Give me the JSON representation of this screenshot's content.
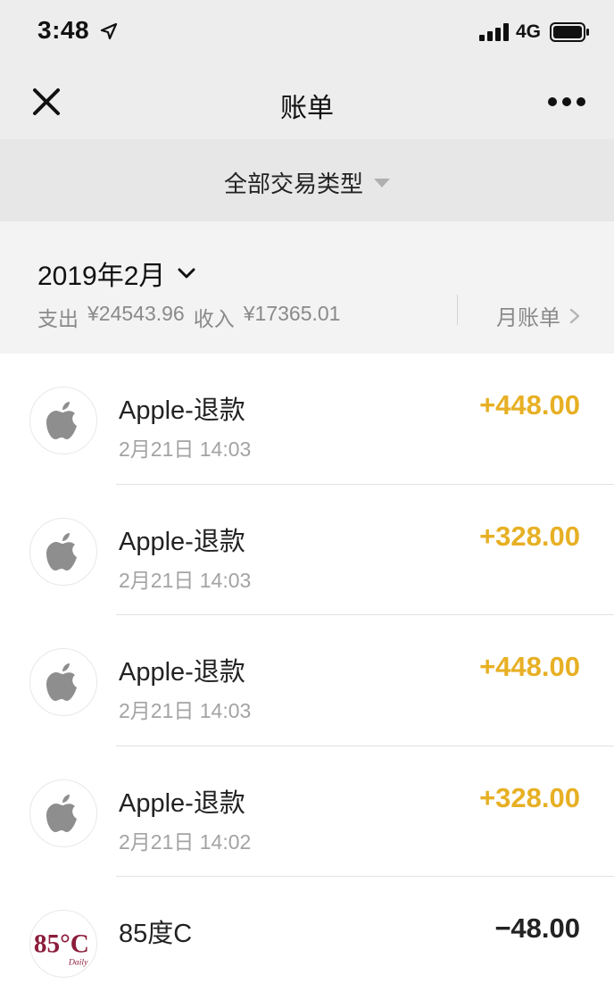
{
  "status_bar": {
    "time": "3:48",
    "network": "4G",
    "icons": [
      "location-arrow-icon",
      "signal-bars-icon",
      "battery-icon"
    ]
  },
  "nav": {
    "title": "账单",
    "left_icon": "close-icon",
    "right_icon": "more-icon"
  },
  "filter": {
    "label": "全部交易类型",
    "icon": "caret-down-icon"
  },
  "summary": {
    "month": "2019年2月",
    "expense_label": "支出",
    "expense_value": "¥24543.96",
    "income_label": "收入",
    "income_value": "¥17365.01",
    "monthly_bill_label": "月账单"
  },
  "colors": {
    "income": "#e7b024",
    "expense": "#222222",
    "header_bg": "#ededed",
    "filter_bg": "#e7e7e7",
    "summary_bg": "#f3f3f3",
    "secondary_text": "#8a8a8a",
    "brand_85c": "#8c1d3c"
  },
  "transactions": [
    {
      "icon": "apple-icon",
      "name": "Apple-退款",
      "time": "2月21日 14:03",
      "amount": "+448.00",
      "type": "income"
    },
    {
      "icon": "apple-icon",
      "name": "Apple-退款",
      "time": "2月21日 14:03",
      "amount": "+328.00",
      "type": "income"
    },
    {
      "icon": "apple-icon",
      "name": "Apple-退款",
      "time": "2月21日 14:03",
      "amount": "+448.00",
      "type": "income"
    },
    {
      "icon": "apple-icon",
      "name": "Apple-退款",
      "time": "2月21日 14:02",
      "amount": "+328.00",
      "type": "income"
    },
    {
      "icon": "85c-logo",
      "name": "85度C",
      "time": "",
      "amount": "−48.00",
      "type": "expense",
      "logo_text": "85°C"
    }
  ]
}
